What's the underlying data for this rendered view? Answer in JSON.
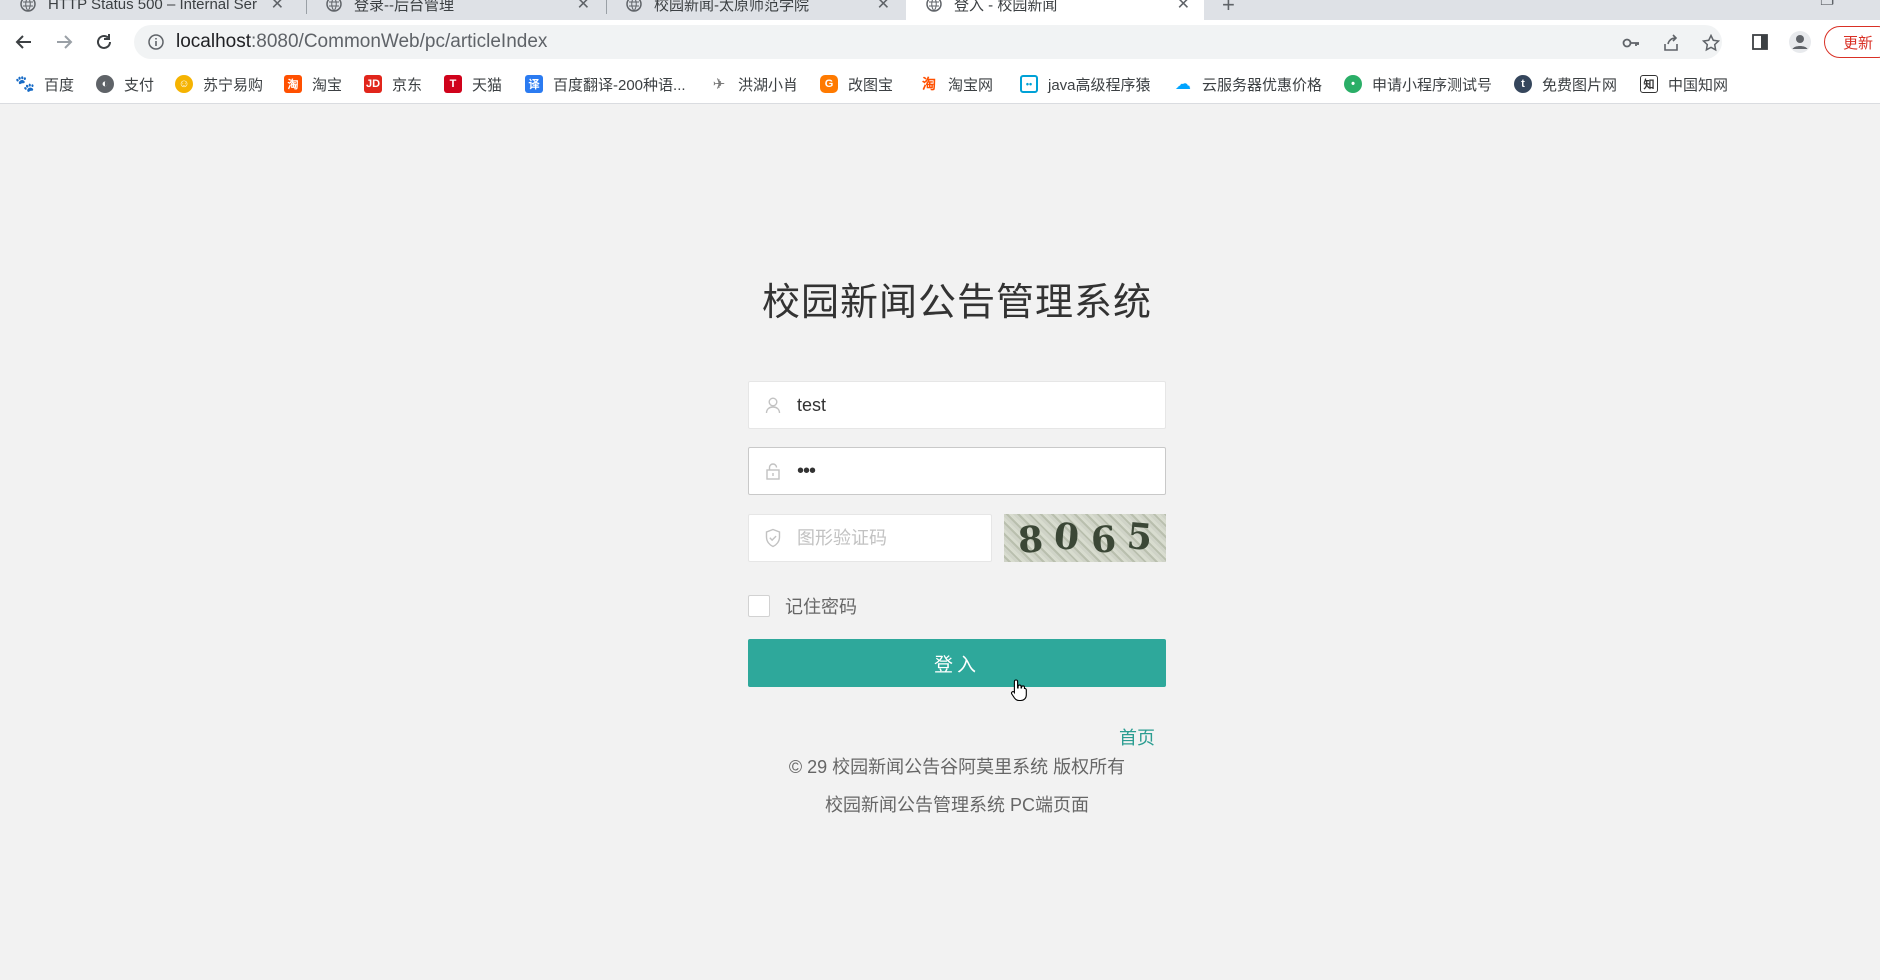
{
  "browser": {
    "tabs": [
      {
        "title": "HTTP Status 500 – Internal Ser",
        "active": false
      },
      {
        "title": "登录--后台管理",
        "active": false
      },
      {
        "title": "校园新闻-太原师范学院",
        "active": false
      },
      {
        "title": "登入 - 校园新闻",
        "active": true
      }
    ],
    "new_tab_label": "+",
    "url_host": "localhost",
    "url_rest": ":8080/CommonWeb/pc/articleIndex",
    "update_label": "更新",
    "bookmarks": [
      {
        "label": "百度",
        "icon": "baidu-icon",
        "color": "#2932e1"
      },
      {
        "label": "支付",
        "icon": "globe-icon",
        "color": "#5f6368"
      },
      {
        "label": "苏宁易购",
        "icon": "suning-icon",
        "color": "#f5b301"
      },
      {
        "label": "淘宝",
        "icon": "taobao-icon",
        "color": "#ff5000"
      },
      {
        "label": "京东",
        "icon": "jd-icon",
        "color": "#e1251b"
      },
      {
        "label": "天猫",
        "icon": "tmall-icon",
        "color": "#d0021b"
      },
      {
        "label": "百度翻译-200种语...",
        "icon": "translate-icon",
        "color": "#2b7bf1"
      },
      {
        "label": "洪湖小肖",
        "icon": "bird-icon",
        "color": "#7a7a7a"
      },
      {
        "label": "改图宝",
        "icon": "gaitubao-icon",
        "color": "#ff7a00"
      },
      {
        "label": "淘宝网",
        "icon": "taobao-icon",
        "color": "#ff5000"
      },
      {
        "label": "java高级程序猿",
        "icon": "bilibili-icon",
        "color": "#00a1d6"
      },
      {
        "label": "云服务器优惠价格",
        "icon": "cloud-icon",
        "color": "#00a4ff"
      },
      {
        "label": "申请小程序测试号",
        "icon": "wechat-icon",
        "color": "#2aae67"
      },
      {
        "label": "免费图片网",
        "icon": "tumblr-icon",
        "color": "#35465c"
      },
      {
        "label": "中国知网",
        "icon": "cnki-icon",
        "color": "#333333"
      }
    ]
  },
  "login": {
    "title": "校园新闻公告管理系统",
    "username_value": "test",
    "password_value": "•••",
    "captcha_placeholder": "图形验证码",
    "captcha_text": [
      "8",
      "0",
      "6",
      "5"
    ],
    "remember_label": "记住密码",
    "remember_checked": false,
    "submit_label": "登入",
    "home_link": "首页"
  },
  "footer": {
    "copyright": "© 29 校园新闻公告谷阿莫里系统 版权所有",
    "subtitle": "校园新闻公告管理系统 PC端页面"
  },
  "colors": {
    "primary": "#2ea89b",
    "link": "#2b9d91",
    "page_bg": "#f2f2f2"
  }
}
